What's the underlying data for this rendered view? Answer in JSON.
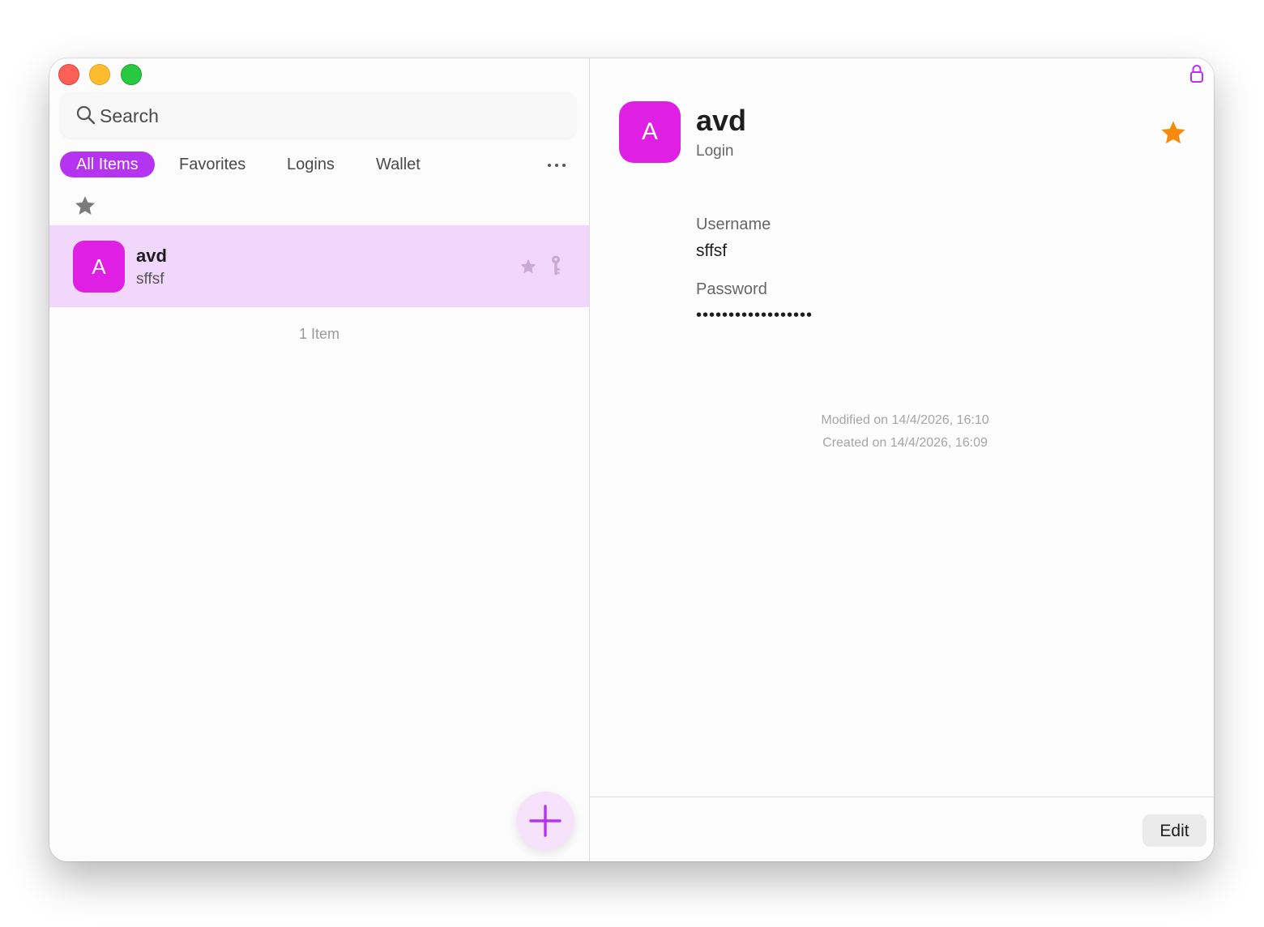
{
  "window": {
    "traffic_lights": [
      "close",
      "minimize",
      "zoom"
    ]
  },
  "search": {
    "placeholder": "Search"
  },
  "tabs": [
    {
      "label": "All Items",
      "active": true
    },
    {
      "label": "Favorites",
      "active": false
    },
    {
      "label": "Logins",
      "active": false
    },
    {
      "label": "Wallet",
      "active": false
    }
  ],
  "more_icon": "ellipsis-icon",
  "favorites_filter_icon": "star-icon",
  "items": [
    {
      "initial": "A",
      "title": "avd",
      "subtitle": "sffsf",
      "favorite": true,
      "icons": [
        "star-icon",
        "key-icon"
      ]
    }
  ],
  "list_count": "1 Item",
  "add_icon": "plus-icon",
  "detail": {
    "lock_icon": "lock-icon",
    "initial": "A",
    "title": "avd",
    "type": "Login",
    "favorite": true,
    "fields": [
      {
        "label": "Username",
        "value": "sffsf"
      },
      {
        "label": "Password",
        "value": "••••••••••••••••••"
      }
    ],
    "modified": "Modified on 14/4/2026, 16:10",
    "created": "Created on 14/4/2026, 16:09",
    "edit_label": "Edit"
  },
  "colors": {
    "accent": "#b534f2",
    "avatar": "#e01fe4",
    "selected_row": "#f2d7fd",
    "favorite_star": "#f7890b"
  }
}
